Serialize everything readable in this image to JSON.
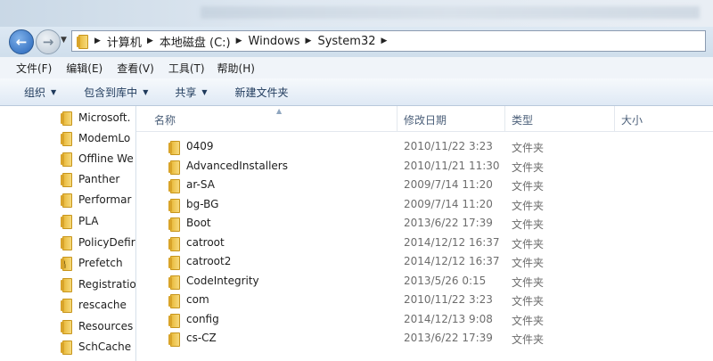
{
  "address": {
    "crumbs": [
      "计算机",
      "本地磁盘 (C:)",
      "Windows",
      "System32"
    ]
  },
  "menu": [
    "文件(F)",
    "编辑(E)",
    "查看(V)",
    "工具(T)",
    "帮助(H)"
  ],
  "toolbar": {
    "organize": "组织",
    "include_in_library": "包含到库中",
    "share": "共享",
    "new_folder": "新建文件夹"
  },
  "nav_pane": {
    "items": [
      {
        "label": "Microsoft."
      },
      {
        "label": "ModemLo"
      },
      {
        "label": "Offline We"
      },
      {
        "label": "Panther"
      },
      {
        "label": "Performar"
      },
      {
        "label": "PLA"
      },
      {
        "label": "PolicyDefir"
      },
      {
        "label": "Prefetch"
      },
      {
        "label": "Registratio"
      },
      {
        "label": "rescache"
      },
      {
        "label": "Resources"
      },
      {
        "label": "SchCache"
      }
    ]
  },
  "columns": {
    "name": "名称",
    "date": "修改日期",
    "type": "类型",
    "size": "大小"
  },
  "files": [
    {
      "name": "0409",
      "date": "2010/11/22 3:23",
      "type": "文件夹"
    },
    {
      "name": "AdvancedInstallers",
      "date": "2010/11/21 11:30",
      "type": "文件夹"
    },
    {
      "name": "ar-SA",
      "date": "2009/7/14 11:20",
      "type": "文件夹"
    },
    {
      "name": "bg-BG",
      "date": "2009/7/14 11:20",
      "type": "文件夹"
    },
    {
      "name": "Boot",
      "date": "2013/6/22 17:39",
      "type": "文件夹"
    },
    {
      "name": "catroot",
      "date": "2014/12/12 16:37",
      "type": "文件夹"
    },
    {
      "name": "catroot2",
      "date": "2014/12/12 16:37",
      "type": "文件夹"
    },
    {
      "name": "CodeIntegrity",
      "date": "2013/5/26 0:15",
      "type": "文件夹"
    },
    {
      "name": "com",
      "date": "2010/11/22 3:23",
      "type": "文件夹"
    },
    {
      "name": "config",
      "date": "2014/12/13 9:08",
      "type": "文件夹"
    },
    {
      "name": "cs-CZ",
      "date": "2013/6/22 17:39",
      "type": "文件夹"
    }
  ],
  "colors": {
    "accent": "#2463b8",
    "folder": "#f2c94c"
  }
}
